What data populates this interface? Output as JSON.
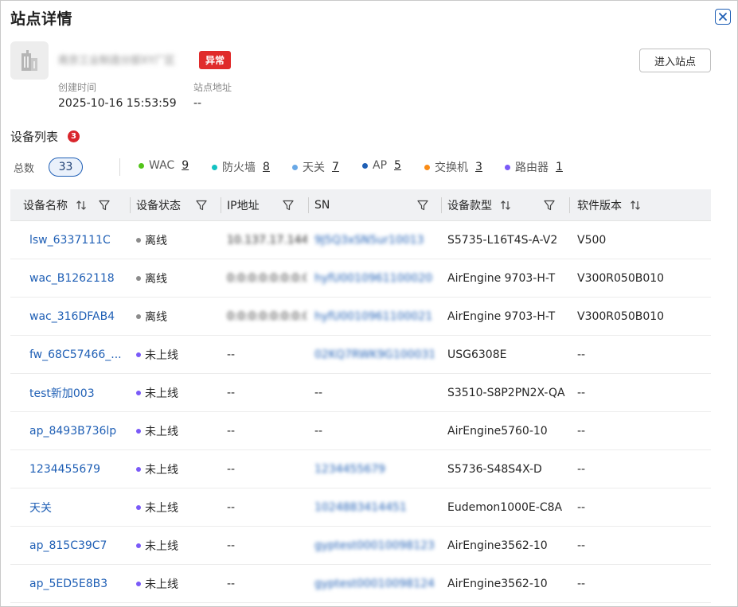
{
  "title": "站点详情",
  "site": {
    "name": "南京工业制造分部XY厂区",
    "status": "异常",
    "enter_button": "进入站点",
    "created_label": "创建时间",
    "created_value": "2025-10-16 15:53:59",
    "address_label": "站点地址",
    "address_value": "--"
  },
  "device_list": {
    "title": "设备列表",
    "badge": "3",
    "total_label": "总数",
    "total": "33",
    "types": [
      {
        "label": "WAC",
        "count": "9",
        "color": "#52c41a"
      },
      {
        "label": "防火墙",
        "count": "8",
        "color": "#13c2c2"
      },
      {
        "label": "天关",
        "count": "7",
        "color": "#69a8e6"
      },
      {
        "label": "AP",
        "count": "5",
        "color": "#1f5fb5"
      },
      {
        "label": "交换机",
        "count": "3",
        "color": "#fa8c16"
      },
      {
        "label": "路由器",
        "count": "1",
        "color": "#7a5af8"
      }
    ]
  },
  "status_colors": {
    "offline": "#8c8c8c",
    "not_online": "#7a5af8"
  },
  "table": {
    "headers": [
      "设备名称",
      "设备状态",
      "IP地址",
      "SN",
      "设备款型",
      "软件版本"
    ],
    "rows": [
      {
        "name": "lsw_6337111C",
        "status": "离线",
        "status_key": "offline",
        "ip": "10.137.17.144",
        "sn": "9J5Q3xSN5ur10013",
        "model": "S5735-L16T4S-A-V2",
        "version": "V500"
      },
      {
        "name": "wac_B1262118",
        "status": "离线",
        "status_key": "offline",
        "ip": "0:0:0:0:0:0:0:0",
        "sn": "hyfU0010961100020",
        "model": "AirEngine 9703-H-T",
        "version": "V300R050B010"
      },
      {
        "name": "wac_316DFAB4",
        "status": "离线",
        "status_key": "offline",
        "ip": "0:0:0:0:0:0:0:0",
        "sn": "hyfU0010961100021",
        "model": "AirEngine 9703-H-T",
        "version": "V300R050B010"
      },
      {
        "name": "fw_68C57466_...",
        "status": "未上线",
        "status_key": "not_online",
        "ip": "--",
        "sn": "02KQ7RWK9G1000318",
        "model": "USG6308E",
        "version": "--"
      },
      {
        "name": "test新加003",
        "status": "未上线",
        "status_key": "not_online",
        "ip": "--",
        "sn": "--",
        "model": "S3510-S8P2PN2X-QA",
        "version": "--"
      },
      {
        "name": "ap_8493B736lp",
        "status": "未上线",
        "status_key": "not_online",
        "ip": "--",
        "sn": "--",
        "model": "AirEngine5760-10",
        "version": "--"
      },
      {
        "name": "1234455679",
        "status": "未上线",
        "status_key": "not_online",
        "ip": "--",
        "sn": "1234455679",
        "model": "S5736-S48S4X-D",
        "version": "--"
      },
      {
        "name": "天关",
        "status": "未上线",
        "status_key": "not_online",
        "ip": "--",
        "sn": "1024883414451",
        "model": "Eudemon1000E-C8A",
        "version": "--"
      },
      {
        "name": "ap_815C39C7",
        "status": "未上线",
        "status_key": "not_online",
        "ip": "--",
        "sn": "gyptest00010098123",
        "model": "AirEngine3562-10",
        "version": "--"
      },
      {
        "name": "ap_5ED5E8B3",
        "status": "未上线",
        "status_key": "not_online",
        "ip": "--",
        "sn": "gyptest00010098124",
        "model": "AirEngine3562-10",
        "version": "--"
      }
    ]
  }
}
